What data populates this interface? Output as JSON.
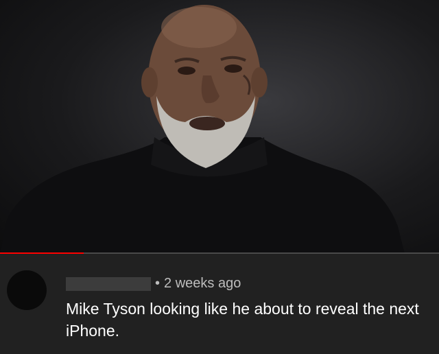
{
  "video": {
    "progress_fraction": 0.19
  },
  "comment": {
    "username": "",
    "separator": "•",
    "timestamp": "2 weeks ago",
    "text": "Mike Tyson looking like he about to reveal the next iPhone."
  },
  "colors": {
    "progress_red": "#ff0000",
    "comment_bg": "#212121",
    "comment_text": "#ffffff",
    "meta_text": "#bdbdbd"
  }
}
